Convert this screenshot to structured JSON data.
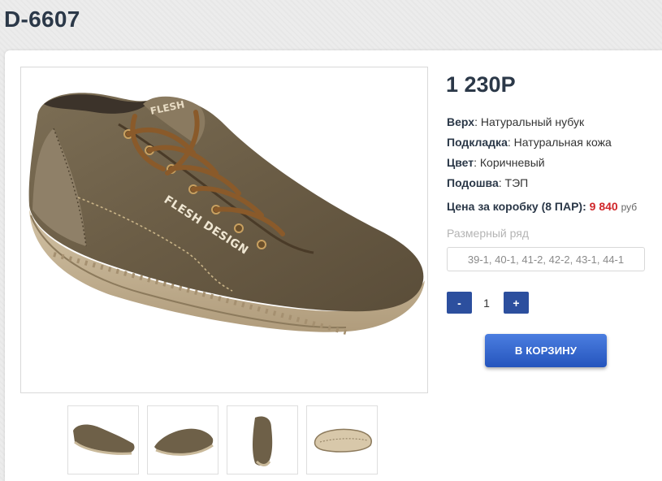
{
  "product": {
    "title": "D-6607",
    "price": "1 230Р",
    "attributes": [
      {
        "label": "Верх",
        "value": "Натуральный нубук"
      },
      {
        "label": "Подкладка",
        "value": "Натуральная кожа"
      },
      {
        "label": "Цвет",
        "value": "Коричневый"
      },
      {
        "label": "Подошва",
        "value": "ТЭП"
      }
    ],
    "box_price": {
      "label": "Цена за коробку (8 ПАР):",
      "value": "9 840",
      "currency": "руб"
    },
    "size_range": {
      "label": "Размерный ряд",
      "value": "39-1, 40-1, 41-2, 42-2, 43-1, 44-1"
    },
    "image_text": {
      "brand": "FLESH DESIGN",
      "tongue": "FLESH"
    }
  },
  "quantity": {
    "minus_label": "-",
    "value": "1",
    "plus_label": "+"
  },
  "cart_button": {
    "label": "В КОРЗИНУ"
  },
  "thumbnails": [
    {
      "name": "thumb-side-view"
    },
    {
      "name": "thumb-angle-view"
    },
    {
      "name": "thumb-front-view"
    },
    {
      "name": "thumb-sole-view"
    }
  ],
  "colors": {
    "title": "#2b3848",
    "accent_red": "#d0262a",
    "button_blue": "#2c4f9e",
    "shoe_brown": "#6e6048"
  }
}
